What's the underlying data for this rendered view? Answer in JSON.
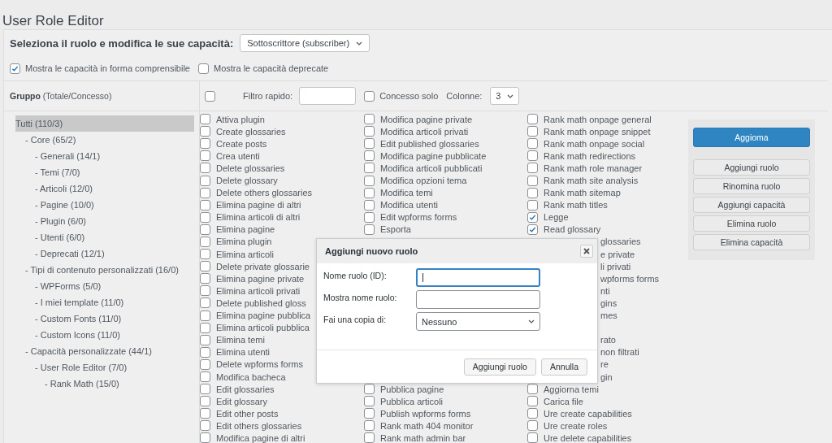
{
  "page_title": "User Role Editor",
  "role_select": {
    "label": "Seleziona il ruolo e modifica le sue capacità:",
    "value": "Sottoscrittore (subscriber)"
  },
  "options": [
    {
      "label": "Mostra le capacità in forma comprensibile",
      "checked": true
    },
    {
      "label": "Mostra le capacità deprecate",
      "checked": false
    }
  ],
  "group_tree": {
    "heading": "**Gruppo** (Totale/Concesso)",
    "items": [
      {
        "label": "Tutti (110/3)",
        "selected": true,
        "children": [
          {
            "label": "- Core (65/2)",
            "selected": false,
            "children": [
              {
                "label": "- Generali (14/1)",
                "selected": false
              },
              {
                "label": "- Temi (7/0)",
                "selected": false
              },
              {
                "label": "- Articoli (12/0)",
                "selected": false
              },
              {
                "label": "- Pagine (10/0)",
                "selected": false
              },
              {
                "label": "- Plugin (6/0)",
                "selected": false
              },
              {
                "label": "- Utenti (6/0)",
                "selected": false
              },
              {
                "label": "- Deprecati (12/1)",
                "selected": false
              }
            ]
          },
          {
            "label": "- Tipi di contenuto personalizzati (16/0)",
            "selected": false,
            "children": [
              {
                "label": "- WPForms (5/0)",
                "selected": false
              },
              {
                "label": "- I miei template (11/0)",
                "selected": false
              },
              {
                "label": "- Custom Fonts (11/0)",
                "selected": false
              },
              {
                "label": "- Custom Icons (11/0)",
                "selected": false
              }
            ]
          },
          {
            "label": "- Capacità personalizzate (44/1)",
            "selected": false,
            "children": [
              {
                "label": "- User Role Editor (7/0)",
                "selected": false,
                "children": [
                  {
                    "label": "- Rank Math (15/0)",
                    "selected": false
                  }
                ]
              }
            ]
          }
        ]
      }
    ]
  },
  "filter_bar": {
    "select_all_checked": false,
    "filter_label": "Filtro rapido:",
    "granted_only": {
      "label": "Concesso solo",
      "checked": false
    },
    "columns_label": "Colonne:",
    "columns_value": "3"
  },
  "capabilities": {
    "columns": [
      {
        "items": [
          {
            "kind": "item",
            "label": "Attiva plugin",
            "checked": false
          },
          {
            "kind": "item",
            "label": "Create glossaries",
            "checked": false
          },
          {
            "kind": "item",
            "label": "Create posts",
            "checked": false
          },
          {
            "kind": "item",
            "label": "Crea utenti",
            "checked": false
          },
          {
            "kind": "item",
            "label": "Delete glossaries",
            "checked": false
          },
          {
            "kind": "item",
            "label": "Delete glossary",
            "checked": false
          },
          {
            "kind": "item",
            "label": "Delete others glossaries",
            "checked": false
          },
          {
            "kind": "item",
            "label": "Elimina pagine di altri",
            "checked": false
          },
          {
            "kind": "item",
            "label": "Elimina articoli di altri",
            "checked": false
          },
          {
            "kind": "item",
            "label": "Elimina pagine",
            "checked": false
          },
          {
            "kind": "item",
            "label": "Elimina plugin",
            "checked": false
          },
          {
            "kind": "item",
            "label": "Elimina articoli",
            "checked": false
          },
          {
            "kind": "item",
            "label": "Delete private glossarie",
            "checked": false
          },
          {
            "kind": "item",
            "label": "Elimina pagine private",
            "checked": false
          },
          {
            "kind": "item",
            "label": "Elimina articoli privati",
            "checked": false
          },
          {
            "kind": "item",
            "label": "Delete published gloss",
            "checked": false
          },
          {
            "kind": "item",
            "label": "Elimina pagine pubblica",
            "checked": false
          },
          {
            "kind": "item",
            "label": "Elimina articoli pubblica",
            "checked": false
          },
          {
            "kind": "item",
            "label": "Elimina temi",
            "checked": false
          },
          {
            "kind": "item",
            "label": "Elimina utenti",
            "checked": false
          },
          {
            "kind": "item",
            "label": "Delete wpforms forms",
            "checked": false
          },
          {
            "kind": "item",
            "label": "Modifica bacheca",
            "checked": false
          },
          {
            "kind": "item",
            "label": "Edit glossaries",
            "checked": false
          },
          {
            "kind": "item",
            "label": "Edit glossary",
            "checked": false
          },
          {
            "kind": "item",
            "label": "Edit other posts",
            "checked": false
          },
          {
            "kind": "item",
            "label": "Edit others glossaries",
            "checked": false
          },
          {
            "kind": "item",
            "label": "Modifica pagine di altri",
            "checked": false
          }
        ]
      },
      {
        "items": [
          {
            "kind": "item",
            "label": "Modifica pagine private",
            "checked": false
          },
          {
            "kind": "item",
            "label": "Modifica articoli privati",
            "checked": false
          },
          {
            "kind": "item",
            "label": "Edit published glossaries",
            "checked": false
          },
          {
            "kind": "item",
            "label": "Modifica pagine pubblicate",
            "checked": false
          },
          {
            "kind": "item",
            "label": "Modifica articoli pubblicati",
            "checked": false
          },
          {
            "kind": "item",
            "label": "Modifica opzioni tema",
            "checked": false
          },
          {
            "kind": "item",
            "label": "Modifica temi",
            "checked": false
          },
          {
            "kind": "item",
            "label": "Modifica utenti",
            "checked": false
          },
          {
            "kind": "item",
            "label": "Edit wpforms forms",
            "checked": false
          },
          {
            "kind": "item",
            "label": "Esporta",
            "checked": false
          },
          {
            "kind": "covered"
          },
          {
            "kind": "covered"
          },
          {
            "kind": "covered"
          },
          {
            "kind": "covered"
          },
          {
            "kind": "covered"
          },
          {
            "kind": "covered"
          },
          {
            "kind": "covered"
          },
          {
            "kind": "covered"
          },
          {
            "kind": "covered"
          },
          {
            "kind": "covered"
          },
          {
            "kind": "covered"
          },
          {
            "kind": "covered"
          },
          {
            "kind": "item",
            "label": "Pubblica pagine",
            "checked": false
          },
          {
            "kind": "item",
            "label": "Pubblica articoli",
            "checked": false
          },
          {
            "kind": "item",
            "label": "Publish wpforms forms",
            "checked": false
          },
          {
            "kind": "item",
            "label": "Rank math 404 monitor",
            "checked": false
          },
          {
            "kind": "item",
            "label": "Rank math admin bar",
            "checked": false
          }
        ]
      },
      {
        "items": [
          {
            "kind": "item",
            "label": "Rank math onpage general",
            "checked": false
          },
          {
            "kind": "item",
            "label": "Rank math onpage snippet",
            "checked": false
          },
          {
            "kind": "item",
            "label": "Rank math onpage social",
            "checked": false
          },
          {
            "kind": "item",
            "label": "Rank math redirections",
            "checked": false
          },
          {
            "kind": "item",
            "label": "Rank math role manager",
            "checked": false
          },
          {
            "kind": "item",
            "label": "Rank math site analysis",
            "checked": false
          },
          {
            "kind": "item",
            "label": "Rank math sitemap",
            "checked": false
          },
          {
            "kind": "item",
            "label": "Rank math titles",
            "checked": false
          },
          {
            "kind": "item",
            "label": "Legge",
            "checked": true
          },
          {
            "kind": "item",
            "label": "Read glossary",
            "checked": true
          },
          {
            "kind": "fragment",
            "label": "glossaries"
          },
          {
            "kind": "fragment",
            "label": "e private"
          },
          {
            "kind": "fragment",
            "label": "li privati"
          },
          {
            "kind": "fragment",
            "label": "wpforms forms"
          },
          {
            "kind": "fragment",
            "label": "nti"
          },
          {
            "kind": "fragment",
            "label": "gins"
          },
          {
            "kind": "fragment",
            "label": "mes"
          },
          {
            "kind": "covered"
          },
          {
            "kind": "fragment",
            "label": "rato"
          },
          {
            "kind": "fragment",
            "label": "non filtrati"
          },
          {
            "kind": "fragment",
            "label": "re"
          },
          {
            "kind": "fragment",
            "label": "gin"
          },
          {
            "kind": "item",
            "label": "Aggiorna temi",
            "checked": false
          },
          {
            "kind": "item",
            "label": "Carica file",
            "checked": false
          },
          {
            "kind": "item",
            "label": "Ure create capabilities",
            "checked": false
          },
          {
            "kind": "item",
            "label": "Ure create roles",
            "checked": false
          },
          {
            "kind": "item",
            "label": "Ure delete capabilities",
            "checked": false
          }
        ]
      }
    ]
  },
  "actions": [
    {
      "label": "Aggioma",
      "kind": "primary"
    },
    {
      "label": "Aggiungi ruolo",
      "kind": "secondary"
    },
    {
      "label": "Rinomina ruolo",
      "kind": "secondary"
    },
    {
      "label": "Aggiungi capacità",
      "kind": "secondary"
    },
    {
      "label": "Elimina ruolo",
      "kind": "secondary"
    },
    {
      "label": "Elimina capacità",
      "kind": "secondary"
    }
  ],
  "dialog": {
    "title": "Aggiungi nuovo ruolo",
    "fields": [
      {
        "label": "Nome ruolo (ID):",
        "kind": "text",
        "focused": true
      },
      {
        "label": "Mostra nome ruolo:",
        "kind": "text",
        "focused": false
      },
      {
        "label": "Fai una copia di:",
        "kind": "select",
        "value": "Nessuno",
        "focused": false
      }
    ],
    "buttons": [
      "Aggiungi ruolo",
      "Annulla"
    ]
  }
}
